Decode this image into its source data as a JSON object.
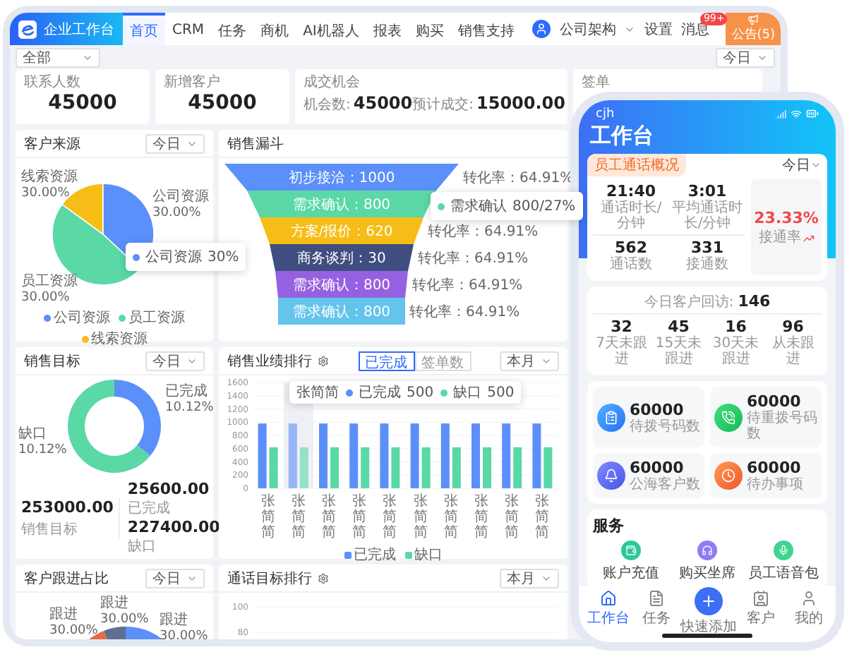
{
  "topbar": {
    "brand": "企业工作台",
    "tabs": [
      {
        "label": "首页",
        "selected": true
      },
      {
        "label": "CRM",
        "selected": false
      },
      {
        "label": "任务",
        "selected": false
      },
      {
        "label": "商机",
        "selected": false
      },
      {
        "label": "AI机器人",
        "selected": false
      },
      {
        "label": "报表",
        "selected": false
      },
      {
        "label": "购买",
        "selected": false
      },
      {
        "label": "销售支持",
        "selected": false
      }
    ],
    "org": "公司架构",
    "settings": "设置",
    "messages": {
      "label": "消息",
      "badge": "99+"
    },
    "notice": "公告(5)"
  },
  "filters": {
    "scope": "全部",
    "period": "今日"
  },
  "stats": [
    {
      "kind": "single",
      "title": "联系人数",
      "value": "45000"
    },
    {
      "kind": "single",
      "title": "新增客户",
      "value": "45000"
    },
    {
      "kind": "pair",
      "title": "成交机会",
      "items": [
        {
          "label": "机会数:",
          "value": "45000"
        },
        {
          "label": "预计成交:",
          "value": "15000.00"
        }
      ]
    },
    {
      "kind": "single",
      "title": "签单"
    }
  ],
  "customer_source": {
    "title": "客户来源",
    "period": "今日",
    "slices": [
      {
        "name": "线索资源",
        "share_label": "30.00%",
        "color": "#f6bd16"
      },
      {
        "name": "公司资源",
        "share_label": "30.00%",
        "color": "#5b8ff9"
      },
      {
        "name": "员工资源",
        "share_label": "30.00%",
        "color": "#5ad8a6"
      }
    ],
    "tooltip": {
      "name": "公司资源",
      "value": "30%",
      "color": "#5b8ff9"
    },
    "legend": [
      {
        "label": "公司资源",
        "color": "#5b8ff9"
      },
      {
        "label": "员工资源",
        "color": "#5ad8a6"
      },
      {
        "label": "线索资源",
        "color": "#f6bd16"
      }
    ]
  },
  "funnel": {
    "title": "销售漏斗",
    "stages": [
      {
        "label": "初步接洽：1000",
        "color": "#5b8ff9",
        "rate": "转化率：64.91%"
      },
      {
        "label": "需求确认：800",
        "color": "#5ad8a6"
      },
      {
        "label": "方案/报价：620",
        "color": "#f6bd16",
        "rate": "转化率：64.91%"
      },
      {
        "label": "商务谈判：30",
        "color": "#3f4d80",
        "rate": "转化率：64.91%"
      },
      {
        "label": "需求确认：800",
        "color": "#9661e0",
        "rate": "转化率：64.91%"
      },
      {
        "label": "需求确认：800",
        "color": "#64c4ec",
        "rate": "转化率：64.91%"
      }
    ],
    "tooltip": {
      "name": "需求确认",
      "value": "800/27%",
      "color": "#5ad8a6"
    }
  },
  "sales_target": {
    "title": "销售目标",
    "period": "今日",
    "segments": [
      {
        "name": "已完成",
        "share_label": "10.12%",
        "color": "#5b8ff9"
      },
      {
        "name": "缺口",
        "share_label": "10.12%",
        "color": "#5ad8a6"
      }
    ],
    "target": {
      "value": "253000.00",
      "label": "销售目标"
    },
    "breakdown": [
      {
        "value": "25600.00",
        "label": "已完成"
      },
      {
        "value": "227400.00",
        "label": "缺口"
      }
    ]
  },
  "ranking": {
    "title": "销售业绩排行",
    "toggle": [
      {
        "label": "已完成",
        "selected": true
      },
      {
        "label": "签单数",
        "selected": false
      }
    ],
    "period": "本月",
    "chart_data": {
      "type": "bar",
      "categories": [
        "张简简",
        "张简简",
        "张简简",
        "张简简",
        "张简简",
        "张简简",
        "张简简",
        "张简简",
        "张简简",
        "张简简"
      ],
      "series": [
        {
          "name": "已完成",
          "color": "#5b8ff9",
          "values": [
            980,
            980,
            980,
            980,
            980,
            980,
            980,
            980,
            980,
            980
          ]
        },
        {
          "name": "缺口",
          "color": "#5ad8a6",
          "values": [
            620,
            620,
            620,
            620,
            620,
            620,
            620,
            620,
            620,
            620
          ]
        }
      ],
      "stacked": false,
      "grid": true,
      "legend": true,
      "ylim": [
        0,
        1600
      ],
      "yticks": [
        0,
        200,
        400,
        600,
        800,
        1000,
        1200,
        1400,
        1600
      ]
    },
    "tooltip": {
      "title": "张简简",
      "rows": [
        {
          "name": "已完成",
          "value": "500",
          "color": "#5b8ff9"
        },
        {
          "name": "缺口",
          "value": "500",
          "color": "#5ad8a6"
        }
      ]
    }
  },
  "followup": {
    "title": "客户跟进占比",
    "period": "今日",
    "slices": [
      {
        "name": "跟进",
        "share_label": "30.00%",
        "color": "#e8684a"
      },
      {
        "name": "跟进",
        "share_label": "30.00%",
        "color": "#5d7092"
      },
      {
        "name": "跟进",
        "share_label": "30.00%",
        "color": "#5b8ff9"
      }
    ]
  },
  "call_ranking": {
    "title": "通话目标排行",
    "period": "本月",
    "axis_labels": [
      "100",
      "80"
    ]
  },
  "phone": {
    "carrier": "cjh",
    "title": "工作台",
    "calls": {
      "tag": "员工通话概况",
      "period": "今日",
      "metrics": [
        {
          "value": "21:40",
          "label": "通话时长/分钟"
        },
        {
          "value": "3:01",
          "label": "平均通话时长/分钟"
        },
        {
          "value": "562",
          "label": "通话数"
        },
        {
          "value": "331",
          "label": "接通数"
        }
      ],
      "rate": {
        "value": "23.33%",
        "label": "接通率"
      }
    },
    "visits": {
      "label": "今日客户回访:",
      "value": "146",
      "buckets": [
        {
          "value": "32",
          "label": "7天未跟进"
        },
        {
          "value": "45",
          "label": "15天未跟进"
        },
        {
          "value": "16",
          "label": "30天未跟进"
        },
        {
          "value": "96",
          "label": "从未跟进"
        }
      ]
    },
    "tiles": [
      {
        "kind": "dial",
        "value": "60000",
        "label": "待拨号码数"
      },
      {
        "kind": "redial",
        "value": "60000",
        "label": "待重拨号码数"
      },
      {
        "kind": "pool",
        "value": "60000",
        "label": "公海客户数"
      },
      {
        "kind": "todo",
        "value": "60000",
        "label": "待办事项"
      }
    ],
    "services": {
      "title": "服务",
      "items": [
        {
          "kind": "recharge",
          "label": "账户充值"
        },
        {
          "kind": "seat",
          "label": "购买坐席"
        },
        {
          "kind": "voice",
          "label": "员工语音包"
        }
      ]
    },
    "nav": [
      {
        "kind": "home",
        "label": "工作台",
        "selected": true
      },
      {
        "kind": "tasks",
        "label": "任务",
        "selected": false
      },
      {
        "kind": "add",
        "label": "快速添加",
        "selected": false
      },
      {
        "kind": "customers",
        "label": "客户",
        "selected": false
      },
      {
        "kind": "me",
        "label": "我的",
        "selected": false
      }
    ]
  }
}
